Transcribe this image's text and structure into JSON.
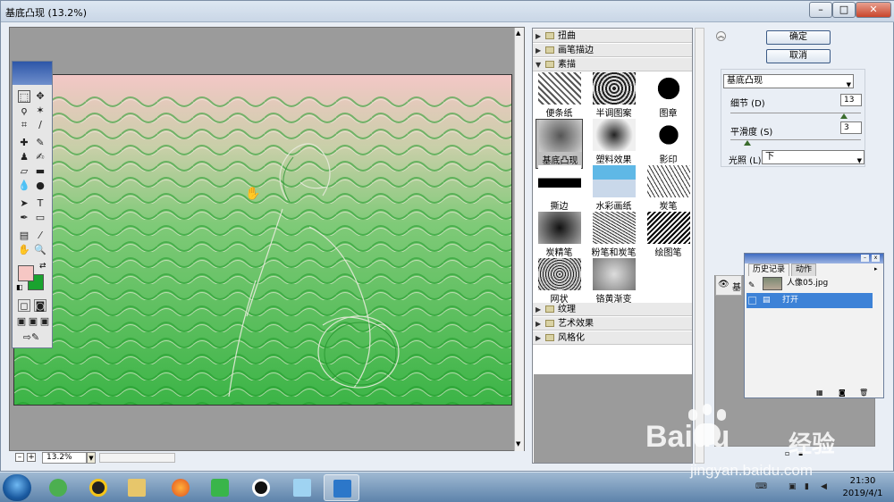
{
  "window": {
    "title": "基底凸现 (13.2%)",
    "min_label": "–",
    "max_label": "□",
    "close_label": "✕"
  },
  "status": {
    "zoom": "13.2%",
    "zoom_minus": "–",
    "zoom_plus": "+"
  },
  "filter_gallery": {
    "folders_top": [
      {
        "label": "扭曲",
        "expanded": false
      },
      {
        "label": "画笔描边",
        "expanded": false
      },
      {
        "label": "素描",
        "expanded": true
      }
    ],
    "thumbnails": [
      {
        "label": "便条纸",
        "selected": false
      },
      {
        "label": "半调图案",
        "selected": false
      },
      {
        "label": "图章",
        "selected": false
      },
      {
        "label": "基底凸现",
        "selected": true
      },
      {
        "label": "塑料效果",
        "selected": false
      },
      {
        "label": "影印",
        "selected": false
      },
      {
        "label": "撕边",
        "selected": false
      },
      {
        "label": "水彩画纸",
        "selected": false
      },
      {
        "label": "炭笔",
        "selected": false
      },
      {
        "label": "炭精笔",
        "selected": false
      },
      {
        "label": "粉笔和炭笔",
        "selected": false
      },
      {
        "label": "绘图笔",
        "selected": false
      },
      {
        "label": "网状",
        "selected": false
      },
      {
        "label": "铬黄渐变",
        "selected": false
      }
    ],
    "folders_bottom": [
      {
        "label": "纹理",
        "expanded": false
      },
      {
        "label": "艺术效果",
        "expanded": false
      },
      {
        "label": "风格化",
        "expanded": false
      }
    ]
  },
  "right_panel": {
    "ok_label": "确定",
    "cancel_label": "取消",
    "collapse_icon": "chevron-up",
    "filter_select": "基底凸现",
    "detail_label": "细节 (D)",
    "detail_value": "13",
    "detail_level": 0.87,
    "smooth_label": "平滑度 (S)",
    "smooth_value": "3",
    "smooth_level": 0.13,
    "light_label": "光照 (L):",
    "light_value": "下"
  },
  "history": {
    "tab_history": "历史记录",
    "tab_actions": "动作",
    "snapshot_name": "人像05.jpg",
    "step_label": "打开",
    "layers_partial_label": "基"
  },
  "taskbar": {
    "time": "21:30",
    "date": "2019/4/1"
  },
  "watermark": {
    "brand": "Baidu",
    "suffix": "经验",
    "url": "jingyan.baidu.com"
  },
  "colors": {
    "foreground": "#f6c7c4",
    "background": "#1aa32f",
    "effect_green": "#36b43c",
    "effect_pink": "#f3c7c6",
    "accent": "#3d82d7"
  }
}
